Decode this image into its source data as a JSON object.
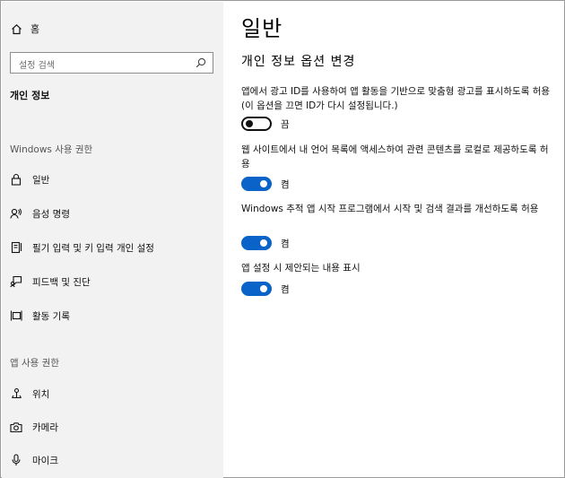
{
  "sidebar": {
    "home_label": "홈",
    "search_placeholder": "설정 검색",
    "section_title": "개인 정보",
    "windows_group": "Windows 사용 권한",
    "windows_items": [
      {
        "label": "일반",
        "icon": "lock-icon"
      },
      {
        "label": "음성 명령",
        "icon": "speech-icon"
      },
      {
        "label": "필기 입력 및 키 입력 개인 설정",
        "icon": "notepad-pen-icon"
      },
      {
        "label": "피드백 및 진단",
        "icon": "feedback-icon"
      },
      {
        "label": "활동 기록",
        "icon": "timeline-icon"
      }
    ],
    "app_group": "앱 사용 권한",
    "app_items": [
      {
        "label": "위치",
        "icon": "location-icon"
      },
      {
        "label": "카메라",
        "icon": "camera-icon"
      },
      {
        "label": "마이크",
        "icon": "microphone-icon"
      }
    ]
  },
  "main": {
    "title": "일반",
    "subtitle": "개인 정보 옵션 변경",
    "settings": [
      {
        "description": "앱에서 광고 ID를 사용하여 앱 활동을 기반으로 맞춤형 광고를 표시하도록 허용(이 옵션을 끄면 ID가 다시 설정됩니다.)",
        "state": "끔",
        "on": false
      },
      {
        "description": "웹 사이트에서 내 언어 목록에 액세스하여 관련 콘텐츠를 로컬로 제공하도록 허용",
        "state": "켬",
        "on": true
      },
      {
        "description": "Windows 추적 앱 시작 프로그램에서 시작 및 검색 결과를 개선하도록 허용",
        "state": "켬",
        "on": true
      },
      {
        "description": "앱 설정 시 제안되는 내용 표시",
        "state": "켬",
        "on": true
      }
    ]
  },
  "colors": {
    "toggle_on": "#0a63c9",
    "sidebar_bg": "#f2f2f2"
  }
}
